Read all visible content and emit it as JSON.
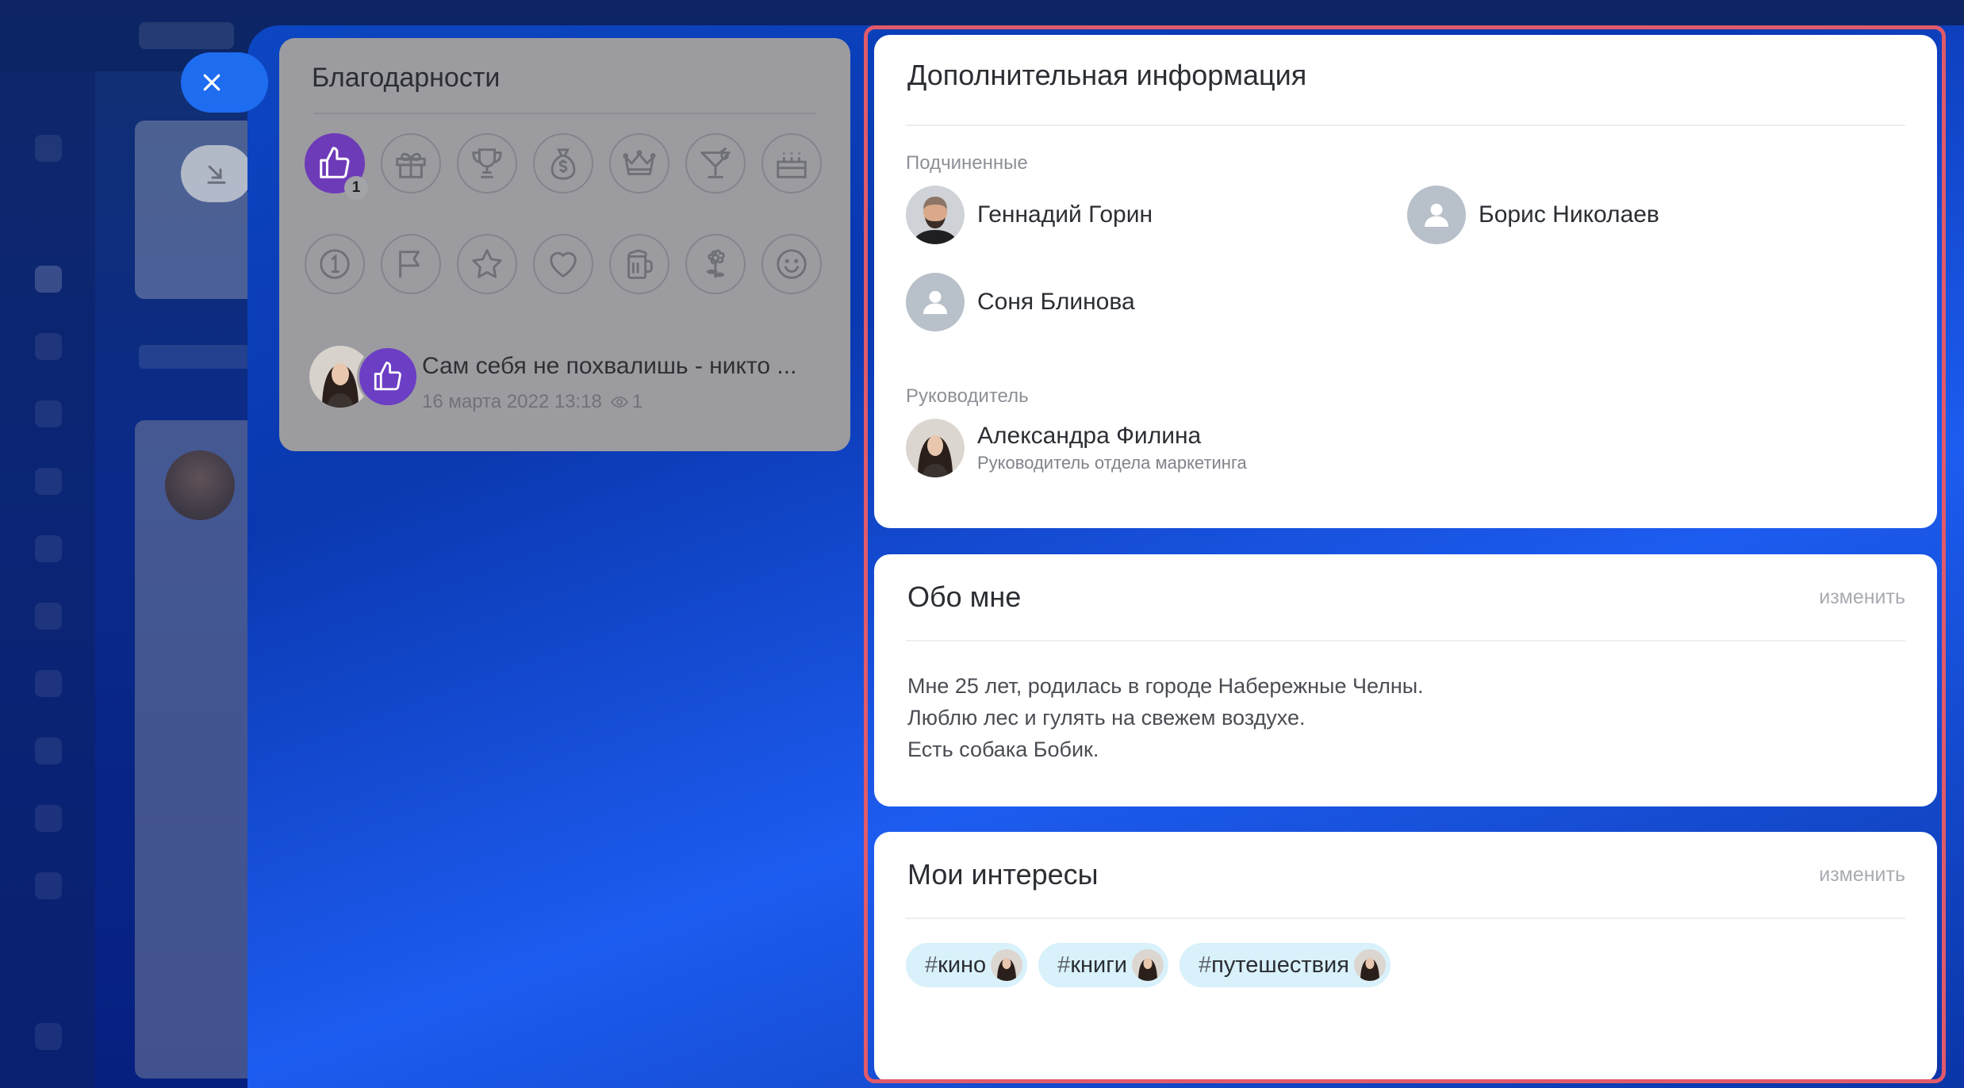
{
  "thanks": {
    "title": "Благодарности",
    "badges_row1": [
      "like-icon",
      "gift-icon",
      "trophy-icon",
      "money-bag-icon",
      "crown-icon",
      "cocktail-icon",
      "cake-icon"
    ],
    "badges_row2": [
      "number-one-icon",
      "flag-icon",
      "star-icon",
      "heart-icon",
      "beer-icon",
      "flower-icon",
      "smile-icon"
    ],
    "active_badge_count": "1",
    "post": {
      "title": "Сам себя не похвалишь - никто ...",
      "date": "16 марта 2022 13:18",
      "views": "1"
    }
  },
  "info": {
    "title": "Дополнительная информация",
    "subordinates_label": "Подчиненные",
    "subordinates": [
      {
        "name": "Геннадий Горин"
      },
      {
        "name": "Борис Николаев"
      },
      {
        "name": "Соня Блинова"
      }
    ],
    "manager_label": "Руководитель",
    "manager": {
      "name": "Александра Филина",
      "position": "Руководитель отдела маркетинга"
    }
  },
  "about": {
    "title": "Обо мне",
    "edit_label": "изменить",
    "lines": [
      "Мне 25 лет, родилась в городе Набережные Челны.",
      "Люблю лес и гулять на свежем воздухе.",
      "Есть собака Бобик."
    ]
  },
  "interests": {
    "title": "Мои интересы",
    "edit_label": "изменить",
    "hash": "#",
    "tags": [
      "кино",
      "книги",
      "путешествия"
    ]
  },
  "colors": {
    "accent": "#1e6cf0",
    "badge_active": "#6e3bb8",
    "highlight": "#e05a6a",
    "tag_bg": "#d8f1fb"
  }
}
